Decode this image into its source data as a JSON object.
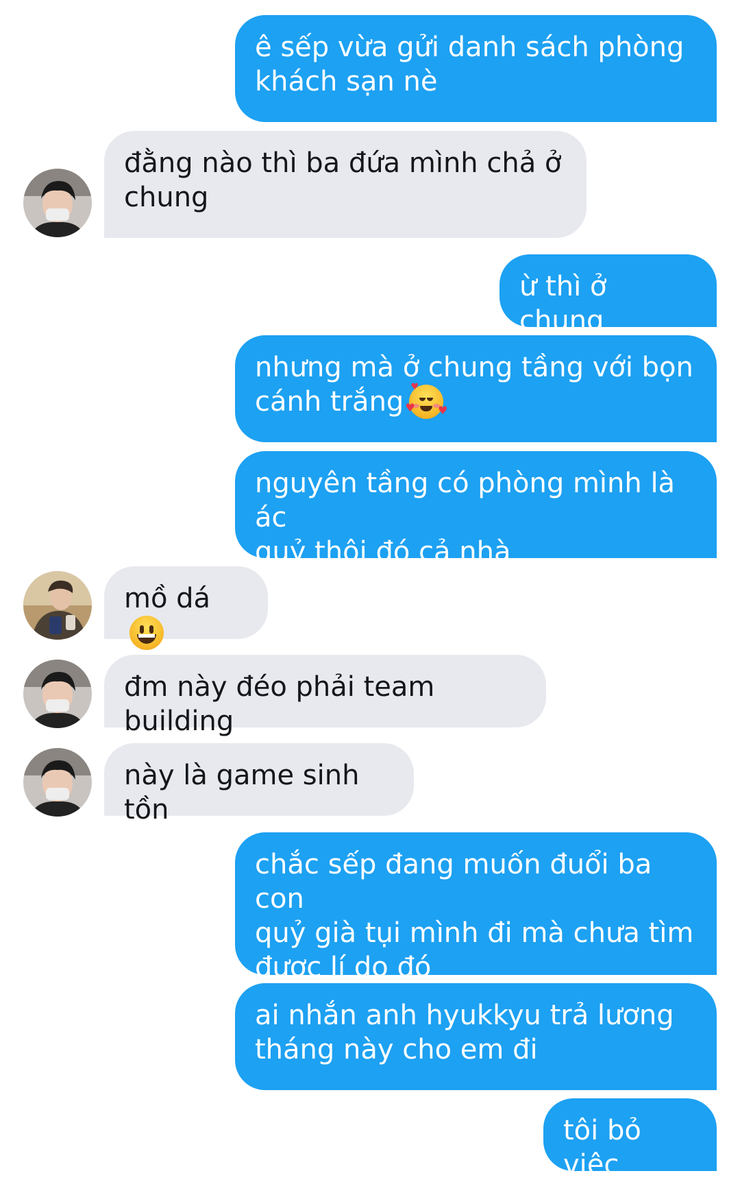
{
  "messages": [
    {
      "side": "out",
      "text": "ê sếp vừa gửi danh sách phòng\nkhách sạn nè"
    },
    {
      "side": "in",
      "avatar": "avatar-boy-mask",
      "text": "đằng nào thì ba đứa mình chả ở\nchung"
    },
    {
      "side": "out",
      "text": "ừ thì ở chung"
    },
    {
      "side": "out",
      "text": "nhưng mà ở chung tầng với bọn\ncánh trắng",
      "emoji": "smiling-face-with-hearts-emoji"
    },
    {
      "side": "out",
      "text": "nguyên tầng có phòng mình là ác\nquỷ thôi đó cả nhà"
    },
    {
      "side": "in",
      "avatar": "avatar-boy-cap",
      "text": "mồ dá",
      "emoji": "grinning-face-emoji"
    },
    {
      "side": "in",
      "avatar": "avatar-boy-mask",
      "text": "đm này đéo phải team building"
    },
    {
      "side": "in",
      "avatar": "avatar-boy-mask",
      "text": "này là game sinh tồn"
    },
    {
      "side": "out",
      "text": "chắc sếp đang muốn đuổi ba con\nquỷ già tụi mình đi mà chưa tìm\nđươc lí do đó"
    },
    {
      "side": "out",
      "text": "ai nhắn anh hyukkyu trả lương\ntháng này cho em đi"
    },
    {
      "side": "out",
      "text": "tôi bỏ việc"
    }
  ],
  "colors": {
    "outgoing_bubble": "#1da1f2",
    "incoming_bubble": "#e7e9ee",
    "outgoing_text": "#ffffff",
    "incoming_text": "#14171a"
  }
}
